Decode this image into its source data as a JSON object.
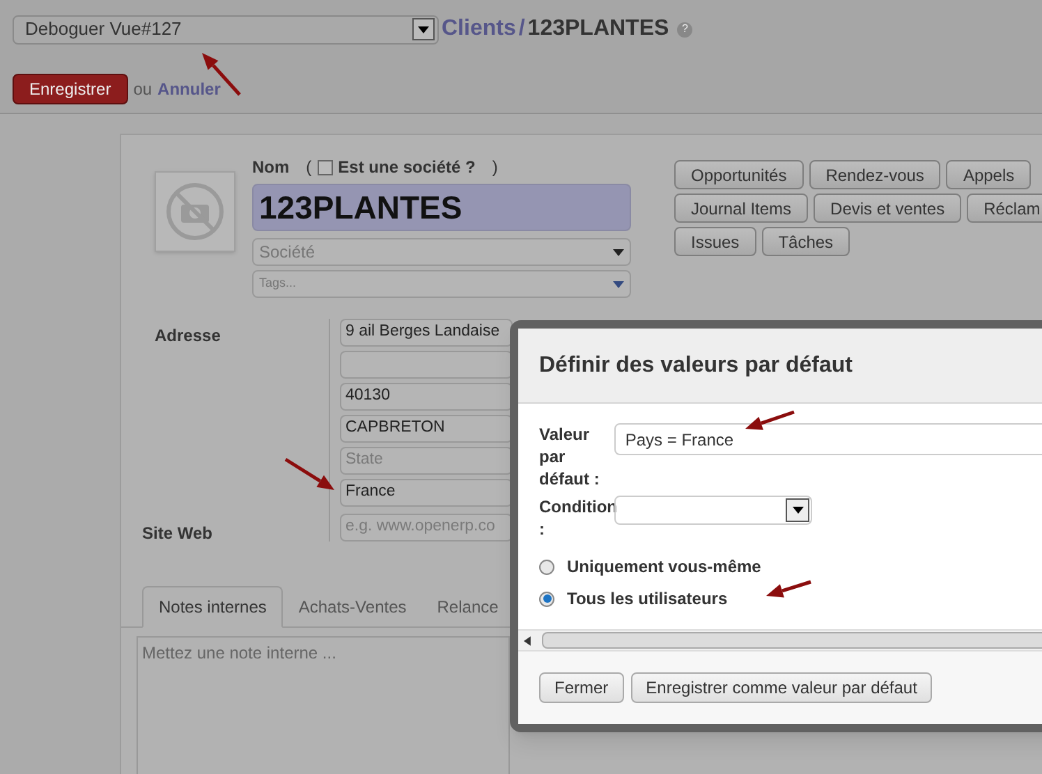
{
  "debug_select": {
    "value": "Deboguer Vue#127"
  },
  "breadcrumb": {
    "parent": "Clients",
    "separator": "/",
    "current": "123PLANTES",
    "help": "?"
  },
  "actions": {
    "save": "Enregistrer",
    "or": "ou",
    "cancel": "Annuler"
  },
  "form": {
    "name_label": "Nom",
    "paren_open": "(",
    "paren_close": ")",
    "company_checkbox": {
      "label": "Est une société ?",
      "checked": false
    },
    "name": "123PLANTES",
    "company_select": {
      "placeholder": "Société"
    },
    "tags": {
      "placeholder": "Tags..."
    },
    "smart_buttons": [
      [
        "Opportunités",
        "Rendez-vous",
        "Appels"
      ],
      [
        "Journal Items",
        "Devis et ventes",
        "Réclam"
      ],
      [
        "Issues",
        "Tâches"
      ]
    ],
    "address_label": "Adresse",
    "address_fields": [
      {
        "kind": "value",
        "text": "9 ail Berges Landaise"
      },
      {
        "kind": "empty"
      },
      {
        "kind": "value",
        "text": "40130"
      },
      {
        "kind": "value",
        "text": "CAPBRETON"
      },
      {
        "kind": "placeholder",
        "text": "State"
      },
      {
        "kind": "value",
        "text": "France"
      }
    ],
    "website_label": "Site Web",
    "website": {
      "placeholder": "e.g. www.openerp.co"
    },
    "tabs": [
      {
        "label": "Notes internes",
        "selected": true
      },
      {
        "label": "Achats-Ventes",
        "selected": false
      },
      {
        "label": "Relance",
        "selected": false
      }
    ],
    "notes": {
      "placeholder": "Mettez une note interne ..."
    }
  },
  "dialog": {
    "title": "Définir des valeurs par défaut",
    "default_label": "Valeur par défaut :",
    "default_value": "Pays = France",
    "condition_label": "Condition :",
    "scope": [
      {
        "label": "Uniquement vous-même",
        "selected": false
      },
      {
        "label": "Tous les utilisateurs",
        "selected": true
      }
    ],
    "buttons": [
      "Fermer",
      "Enregistrer comme valeur par défaut"
    ]
  }
}
